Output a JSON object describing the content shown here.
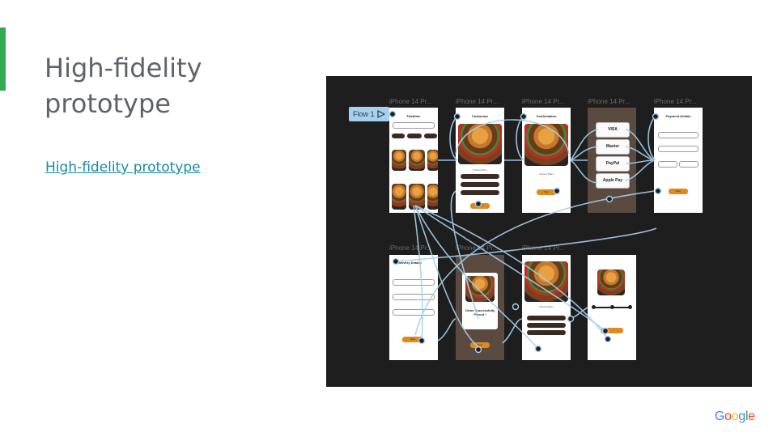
{
  "slide": {
    "title": "High-fidelity prototype",
    "link_text": "High-fidelity prototype"
  },
  "prototype": {
    "flow_label": "Flow 1",
    "flow_icon": "play-triangle-icon",
    "frame_label": "iPhone 14 Pr...",
    "screens": {
      "home_title": "FastDine",
      "customize_title": "Customize",
      "confirmation_title": "Confirmation",
      "payment_title": "Payment Details",
      "delivery_title": "Delivery Details",
      "customize_item": "Cheesy Bites",
      "order_text": "Order Successfully Placed !",
      "payment_options": [
        "VISA",
        "Master",
        "PayPal",
        "Apple Pay"
      ],
      "button_next": "Next",
      "button_pay": "Pay"
    }
  },
  "brand": {
    "logo_text": "Google",
    "logo_colors": [
      "#4285F4",
      "#EA4335",
      "#FBBC05",
      "#4285F4",
      "#34A853",
      "#EA4335"
    ]
  },
  "colors": {
    "accent": "#34a853",
    "link": "#1a8aa5",
    "canvas": "#1e1e1e",
    "wire": "#a7d0ee",
    "button": "#e08a1e"
  }
}
